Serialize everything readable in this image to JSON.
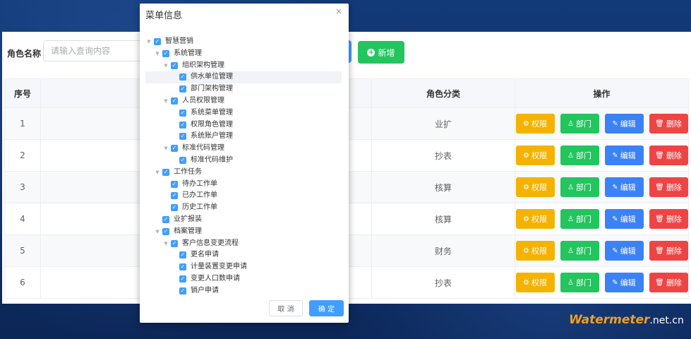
{
  "search": {
    "label": "角色名称",
    "placeholder": "请输入查询内容",
    "add_label": "新增"
  },
  "table": {
    "headers": [
      "序号",
      "",
      "角色分类",
      "操作"
    ],
    "rows": [
      {
        "index": "1",
        "category": "业扩"
      },
      {
        "index": "2",
        "category": "抄表"
      },
      {
        "index": "3",
        "category": "核算"
      },
      {
        "index": "4",
        "category": "核算"
      },
      {
        "index": "5",
        "category": "财务"
      },
      {
        "index": "6",
        "category": "抄表"
      }
    ],
    "actions": {
      "perm": "权限",
      "dept": "部门",
      "edit": "编辑",
      "del": "删除"
    }
  },
  "modal": {
    "title": "菜单信息",
    "close": "×",
    "cancel": "取 消",
    "ok": "确 定",
    "tree": [
      {
        "label": "智慧营销",
        "level": 0,
        "expandable": true,
        "checked": true
      },
      {
        "label": "系统管理",
        "level": 1,
        "expandable": true,
        "checked": true
      },
      {
        "label": "组织架构管理",
        "level": 2,
        "expandable": true,
        "checked": true
      },
      {
        "label": "供水单位管理",
        "level": 3,
        "expandable": false,
        "checked": true,
        "highlight": true
      },
      {
        "label": "部门架构管理",
        "level": 3,
        "expandable": false,
        "checked": true
      },
      {
        "label": "人员权限管理",
        "level": 2,
        "expandable": true,
        "checked": true
      },
      {
        "label": "系统菜单管理",
        "level": 3,
        "expandable": false,
        "checked": true
      },
      {
        "label": "权限角色管理",
        "level": 3,
        "expandable": false,
        "checked": true
      },
      {
        "label": "系统账户管理",
        "level": 3,
        "expandable": false,
        "checked": true
      },
      {
        "label": "标准代码管理",
        "level": 2,
        "expandable": true,
        "checked": true
      },
      {
        "label": "标准代码维护",
        "level": 3,
        "expandable": false,
        "checked": true
      },
      {
        "label": "工作任务",
        "level": 1,
        "expandable": true,
        "checked": true
      },
      {
        "label": "待办工作单",
        "level": 2,
        "expandable": false,
        "checked": true
      },
      {
        "label": "已办工作单",
        "level": 2,
        "expandable": false,
        "checked": true
      },
      {
        "label": "历史工作单",
        "level": 2,
        "expandable": false,
        "checked": true
      },
      {
        "label": "业扩报装",
        "level": 1,
        "expandable": false,
        "checked": true
      },
      {
        "label": "档案管理",
        "level": 1,
        "expandable": true,
        "checked": true
      },
      {
        "label": "客户信息变更流程",
        "level": 2,
        "expandable": true,
        "checked": true
      },
      {
        "label": "更名申请",
        "level": 3,
        "expandable": false,
        "checked": true
      },
      {
        "label": "计量装置变更申请",
        "level": 3,
        "expandable": false,
        "checked": true
      },
      {
        "label": "变更人口数申请",
        "level": 3,
        "expandable": false,
        "checked": true
      },
      {
        "label": "销户申请",
        "level": 3,
        "expandable": false,
        "checked": true
      }
    ]
  },
  "watermark": {
    "brand": "Watermeter",
    "suffix": ".net.cn"
  },
  "colors": {
    "primary": "#409eff",
    "success": "#22c55e",
    "warning": "#f5b301",
    "danger": "#ef4444"
  }
}
